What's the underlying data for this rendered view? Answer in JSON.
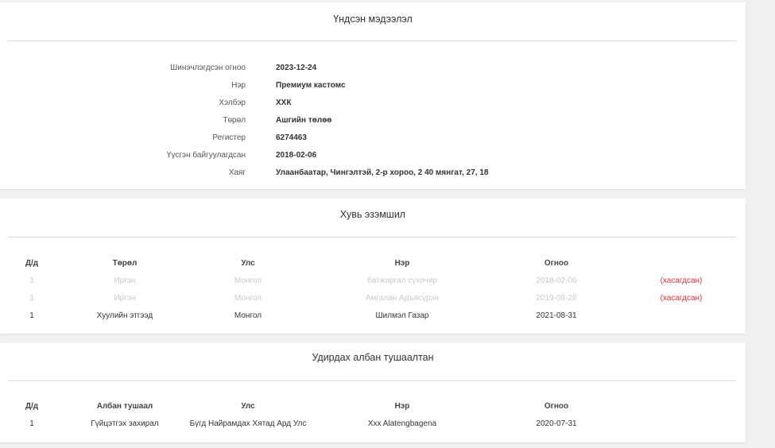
{
  "basic_info": {
    "title": "Үндсэн мэдээлэл",
    "rows": [
      {
        "label": "Шинэчлэгдсэн огноо",
        "value": "2023-12-24"
      },
      {
        "label": "Нэр",
        "value": "Премиум кастомс"
      },
      {
        "label": "Хэлбэр",
        "value": "ХХК"
      },
      {
        "label": "Төрөл",
        "value": "Ашгийн төлөө"
      },
      {
        "label": "Регистер",
        "value": "6274463"
      },
      {
        "label": "Үүсгэн байгуулагдсан",
        "value": "2018-02-06"
      },
      {
        "label": "Хаяг",
        "value": "Улаанбаатар, Чингэлтэй, 2-р хороо, 2 40 мянгат, 27, 18"
      }
    ]
  },
  "ownership": {
    "title": "Хувь эзэмшил",
    "headers": [
      "Д/д",
      "Төрөл",
      "Улс",
      "Нэр",
      "Огноо"
    ],
    "rows": [
      {
        "no": "1",
        "type": "Иргэн",
        "country": "Монгол",
        "name": "батжаргал сүхочир",
        "date": "2018-02-06",
        "status": "(хасагдсан)",
        "removed": true
      },
      {
        "no": "1",
        "type": "Иргэн",
        "country": "Монгол",
        "name": "Амгалан Адъясүрэн",
        "date": "2019-08-28",
        "status": "(хасагдсан)",
        "removed": true
      },
      {
        "no": "1",
        "type": "Хуулийн этгээд",
        "country": "Монгол",
        "name": "Шилмэл Газар",
        "date": "2021-08-31",
        "status": "",
        "removed": false
      }
    ]
  },
  "management": {
    "title": "Удирдах албан тушаалтан",
    "headers": [
      "Д/д",
      "Албан тушаал",
      "Улс",
      "Нэр",
      "Огноо"
    ],
    "rows": [
      {
        "no": "1",
        "position": "Гүйцэтгэх захирал",
        "country": "Бүгд Найрамдах Хятад Ард Улс",
        "name": "Xxx Alatengbagena",
        "date": "2020-07-31"
      }
    ]
  },
  "colors": {
    "removed": "#e0303a",
    "muted_text": "#c8c8c8"
  }
}
